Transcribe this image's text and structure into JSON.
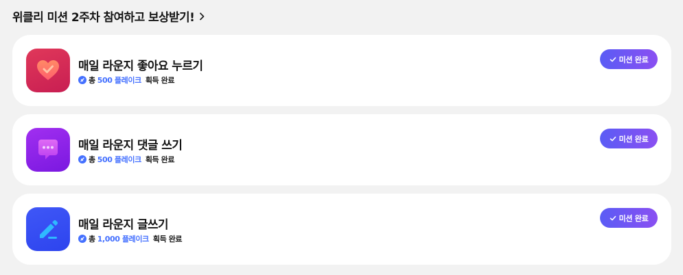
{
  "header": {
    "title": "위클리 미션 2주차 참여하고 보상받기!",
    "chevron_icon": "chevron-right-icon"
  },
  "colors": {
    "accent_blue": "#4470ff",
    "badge_gradient_start": "#5a5cf5",
    "badge_gradient_end": "#8a4ff2"
  },
  "missions": [
    {
      "title": "매일 라운지 좋아요 누르기",
      "icon": "heart-icon",
      "reward_prefix": "총",
      "reward_amount": "500 플레이크",
      "reward_suffix": "획득 완료",
      "status_label": "미션 완료"
    },
    {
      "title": "매일 라운지 댓글 쓰기",
      "icon": "chat-bubble-icon",
      "reward_prefix": "총",
      "reward_amount": "500 플레이크",
      "reward_suffix": "획득 완료",
      "status_label": "미션 완료"
    },
    {
      "title": "매일 라운지 글쓰기",
      "icon": "pencil-icon",
      "reward_prefix": "총",
      "reward_amount": "1,000 플레이크",
      "reward_suffix": "획득 완료",
      "status_label": "미션 완료"
    }
  ]
}
